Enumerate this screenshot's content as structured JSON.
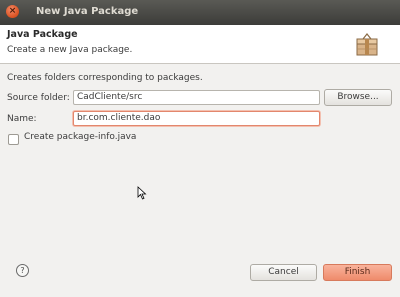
{
  "window": {
    "title": "New Java Package"
  },
  "header": {
    "title": "Java Package",
    "description": "Create a new Java package."
  },
  "info": "Creates folders corresponding to packages.",
  "fields": {
    "source_folder": {
      "label": "Source folder:",
      "value": "CadCliente/src"
    },
    "name": {
      "label": "Name:",
      "value": "br.com.cliente.dao"
    }
  },
  "buttons": {
    "browse": "Browse...",
    "cancel": "Cancel",
    "finish": "Finish"
  },
  "checkbox": {
    "label": "Create package-info.java",
    "checked": false
  },
  "icons": {
    "close": "close-icon",
    "package": "package-icon",
    "help": "help-icon"
  },
  "colors": {
    "accent": "#ef8b6b",
    "titlebar": "#3c3c39"
  }
}
